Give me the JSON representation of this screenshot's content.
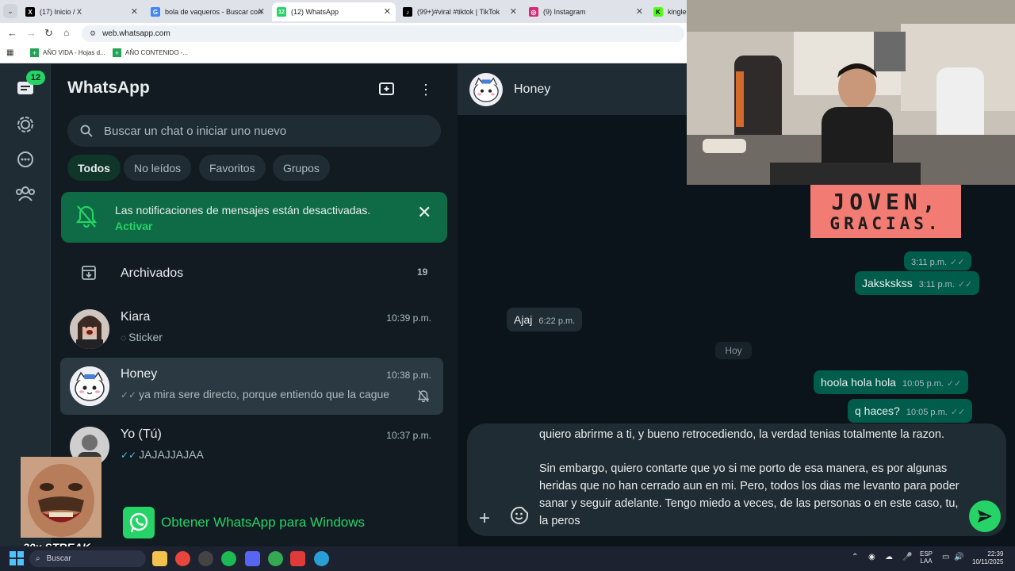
{
  "browser": {
    "tabs": [
      {
        "title": "(17) Inicio / X",
        "favicon": "X"
      },
      {
        "title": "bola de vaqueros - Buscar con",
        "favicon": "G"
      },
      {
        "title": "(12) WhatsApp",
        "favicon": "12"
      },
      {
        "title": "(99+)#viral #tiktok | TikTok",
        "favicon": "♪"
      },
      {
        "title": "(9) Instagram",
        "favicon": "◎"
      },
      {
        "title": "kingleo",
        "favicon": "K"
      }
    ],
    "url": "web.whatsapp.com",
    "bookmarks": [
      "AÑO VIDA - Hojas d...",
      "AÑO CONTENIDO -..."
    ]
  },
  "rail": {
    "badge": "12"
  },
  "sidebar": {
    "title": "WhatsApp",
    "search_placeholder": "Buscar un chat o iniciar uno nuevo",
    "filters": [
      "Todos",
      "No leídos",
      "Favoritos",
      "Grupos"
    ],
    "notification": {
      "text": "Las notificaciones de mensajes están desactivadas.",
      "action": "Activar"
    },
    "archived": {
      "label": "Archivados",
      "count": "19"
    },
    "chats": [
      {
        "name": "Kiara",
        "time": "10:39 p.m.",
        "preview": "Sticker"
      },
      {
        "name": "Honey",
        "time": "10:38 p.m.",
        "preview": "ya mira sere directo,  porque entiendo que la cague"
      },
      {
        "name": "Yo (Tú)",
        "time": "10:37 p.m.",
        "preview": "JAJAJJAJAA"
      }
    ],
    "get_app": "Obtener WhatsApp para Windows"
  },
  "conversation": {
    "contact": "Honey",
    "messages": [
      {
        "text": "",
        "time": "3:11 p.m."
      },
      {
        "text": "Jakskskss",
        "time": "3:11 p.m."
      },
      {
        "text": "Ajaj",
        "time": "6:22 p.m."
      },
      {
        "text": "hoola hola hola",
        "time": "10:05 p.m."
      },
      {
        "text": "q haces?",
        "time": "10:05 p.m."
      }
    ],
    "day_separator": "Hoy",
    "draft": "quiero abrirme a ti, y bueno retrocediendo, la verdad tenias totalmente la razon.\n\nSin embargo, quiero contarte que yo si me porto de esa manera, es por algunas heridas que no han cerrado aun en mi. Pero, todos los dias me levanto para poder sanar y seguir adelante. Tengo miedo a veces, de las personas o en este caso, tu, la peros"
  },
  "overlay": {
    "banner_line1": "JOVEN,",
    "banner_line2": "GRACIAS.",
    "streak": "20x STREAK"
  },
  "taskbar": {
    "search": "Buscar",
    "lang_top": "ESP",
    "lang_bottom": "LAA",
    "time": "22:39",
    "date": "10/11/2025"
  }
}
